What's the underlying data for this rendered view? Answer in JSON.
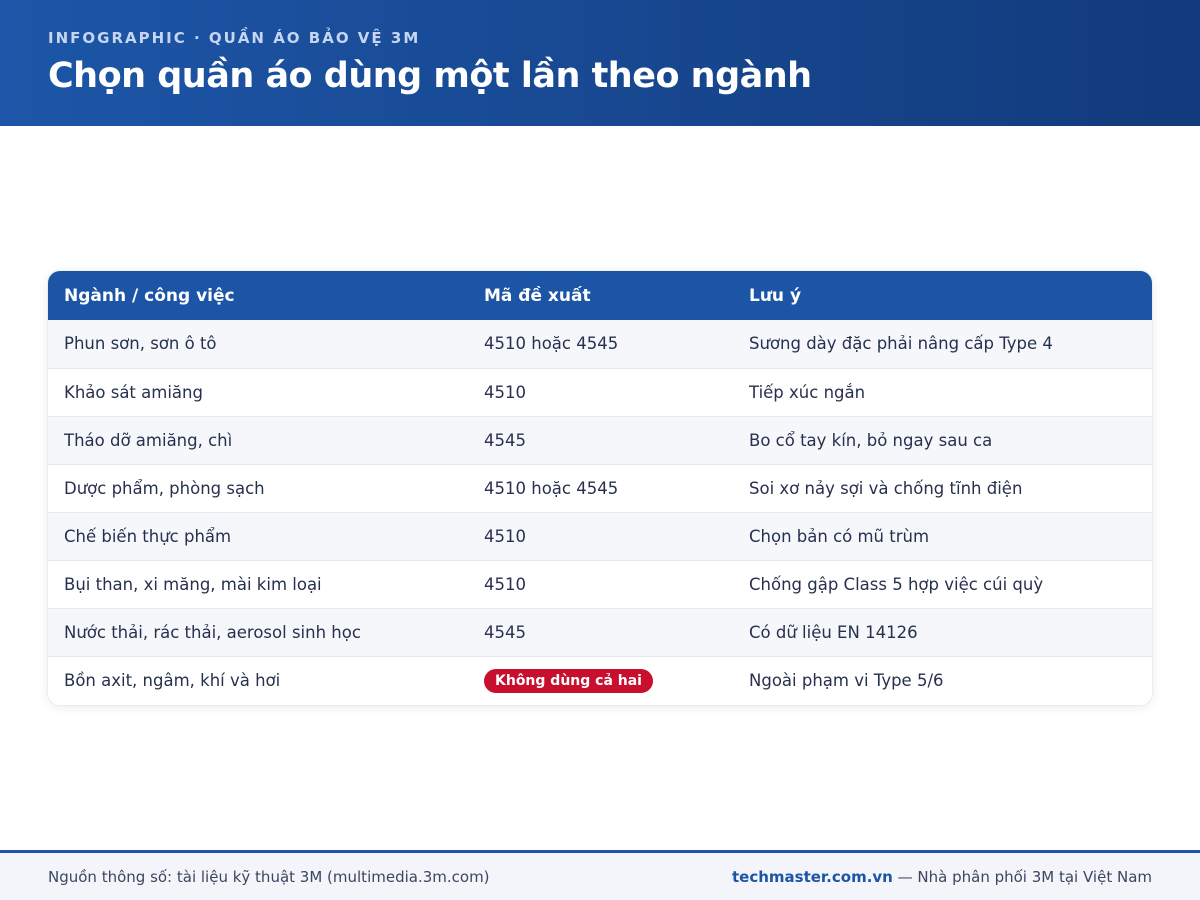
{
  "header": {
    "eyebrow": "INFOGRAPHIC · QUẦN ÁO BẢO VỆ 3M",
    "title": "Chọn quần áo dùng một lần theo ngành"
  },
  "table": {
    "columns": [
      "Ngành / công việc",
      "Mã đề xuất",
      "Lưu ý"
    ],
    "rows": [
      {
        "industry": "Phun sơn, sơn ô tô",
        "code": "4510 hoặc 4545",
        "note": "Sương dày đặc phải nâng cấp Type 4"
      },
      {
        "industry": "Khảo sát amiăng",
        "code": "4510",
        "note": "Tiếp xúc ngắn"
      },
      {
        "industry": "Tháo dỡ amiăng, chì",
        "code": "4545",
        "note": "Bo cổ tay kín, bỏ ngay sau ca"
      },
      {
        "industry": "Dược phẩm, phòng sạch",
        "code": "4510 hoặc 4545",
        "note": "Soi xơ nảy sợi và chống tĩnh điện"
      },
      {
        "industry": "Chế biến thực phẩm",
        "code": "4510",
        "note": "Chọn bản có mũ trùm"
      },
      {
        "industry": "Bụi than, xi măng, mài kim loại",
        "code": "4510",
        "note": "Chống gập Class 5 hợp việc cúi quỳ"
      },
      {
        "industry": "Nước thải, rác thải, aerosol sinh học",
        "code": "4545",
        "note": "Có dữ liệu EN 14126"
      },
      {
        "industry": "Bồn axit, ngâm, khí và hơi",
        "code_badge": "Không dùng cả hai",
        "note": "Ngoài phạm vi Type 5/6"
      }
    ]
  },
  "footer": {
    "source": "Nguồn thông số: tài liệu kỹ thuật 3M (multimedia.3m.com)",
    "brand": "techmaster.com.vn",
    "tagline": " — Nhà phân phối 3M tại Việt Nam"
  },
  "colors": {
    "primary": "#1c55a6",
    "warning_badge": "#c8102e",
    "row_alt": "#f5f7fb"
  }
}
